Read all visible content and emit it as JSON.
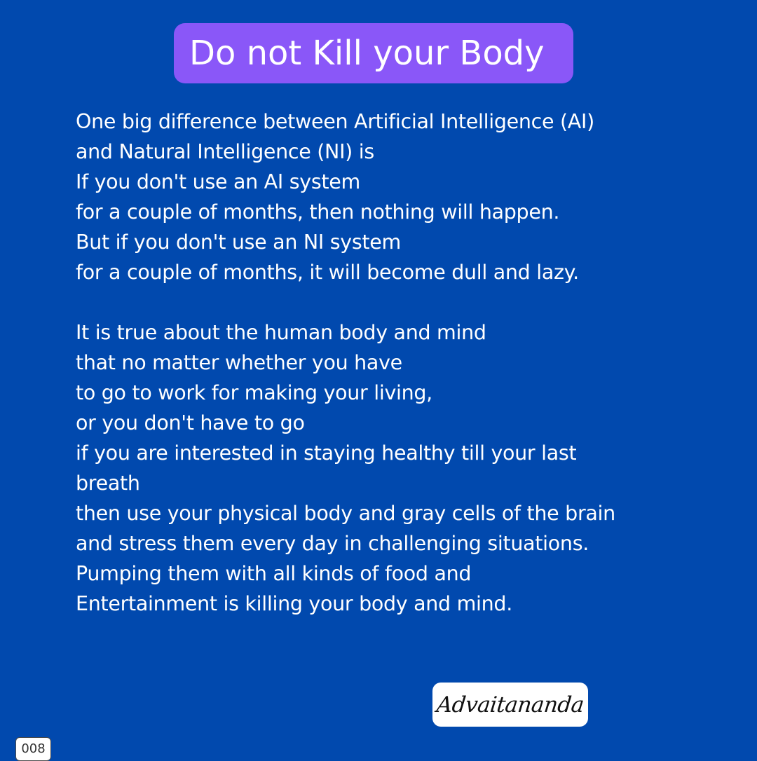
{
  "title": "Do not Kill your Body",
  "body": {
    "lines": [
      "One big difference between Artificial Intelligence (AI)",
      "and Natural Intelligence (NI) is",
      "If you don't use an AI system",
      "for a couple of months, then nothing will happen.",
      "But if you don't use an NI system",
      "for a couple of months, it will become dull and lazy.",
      "",
      "It is true about the human body and mind",
      "that no matter whether you have",
      "to go to work for making your living,",
      "or you don't have to go",
      "if you are interested in staying healthy till your last",
      "breath",
      "then use your physical body and gray cells of the brain",
      "and stress them every day in challenging situations.",
      "Pumping them with all kinds of food and",
      "Entertainment is killing your body and mind."
    ]
  },
  "signature": "Advaitananda",
  "page_number": "008",
  "colors": {
    "background": "#0149AE",
    "title_box": "#8A57F8",
    "text": "#FFFFFF"
  }
}
